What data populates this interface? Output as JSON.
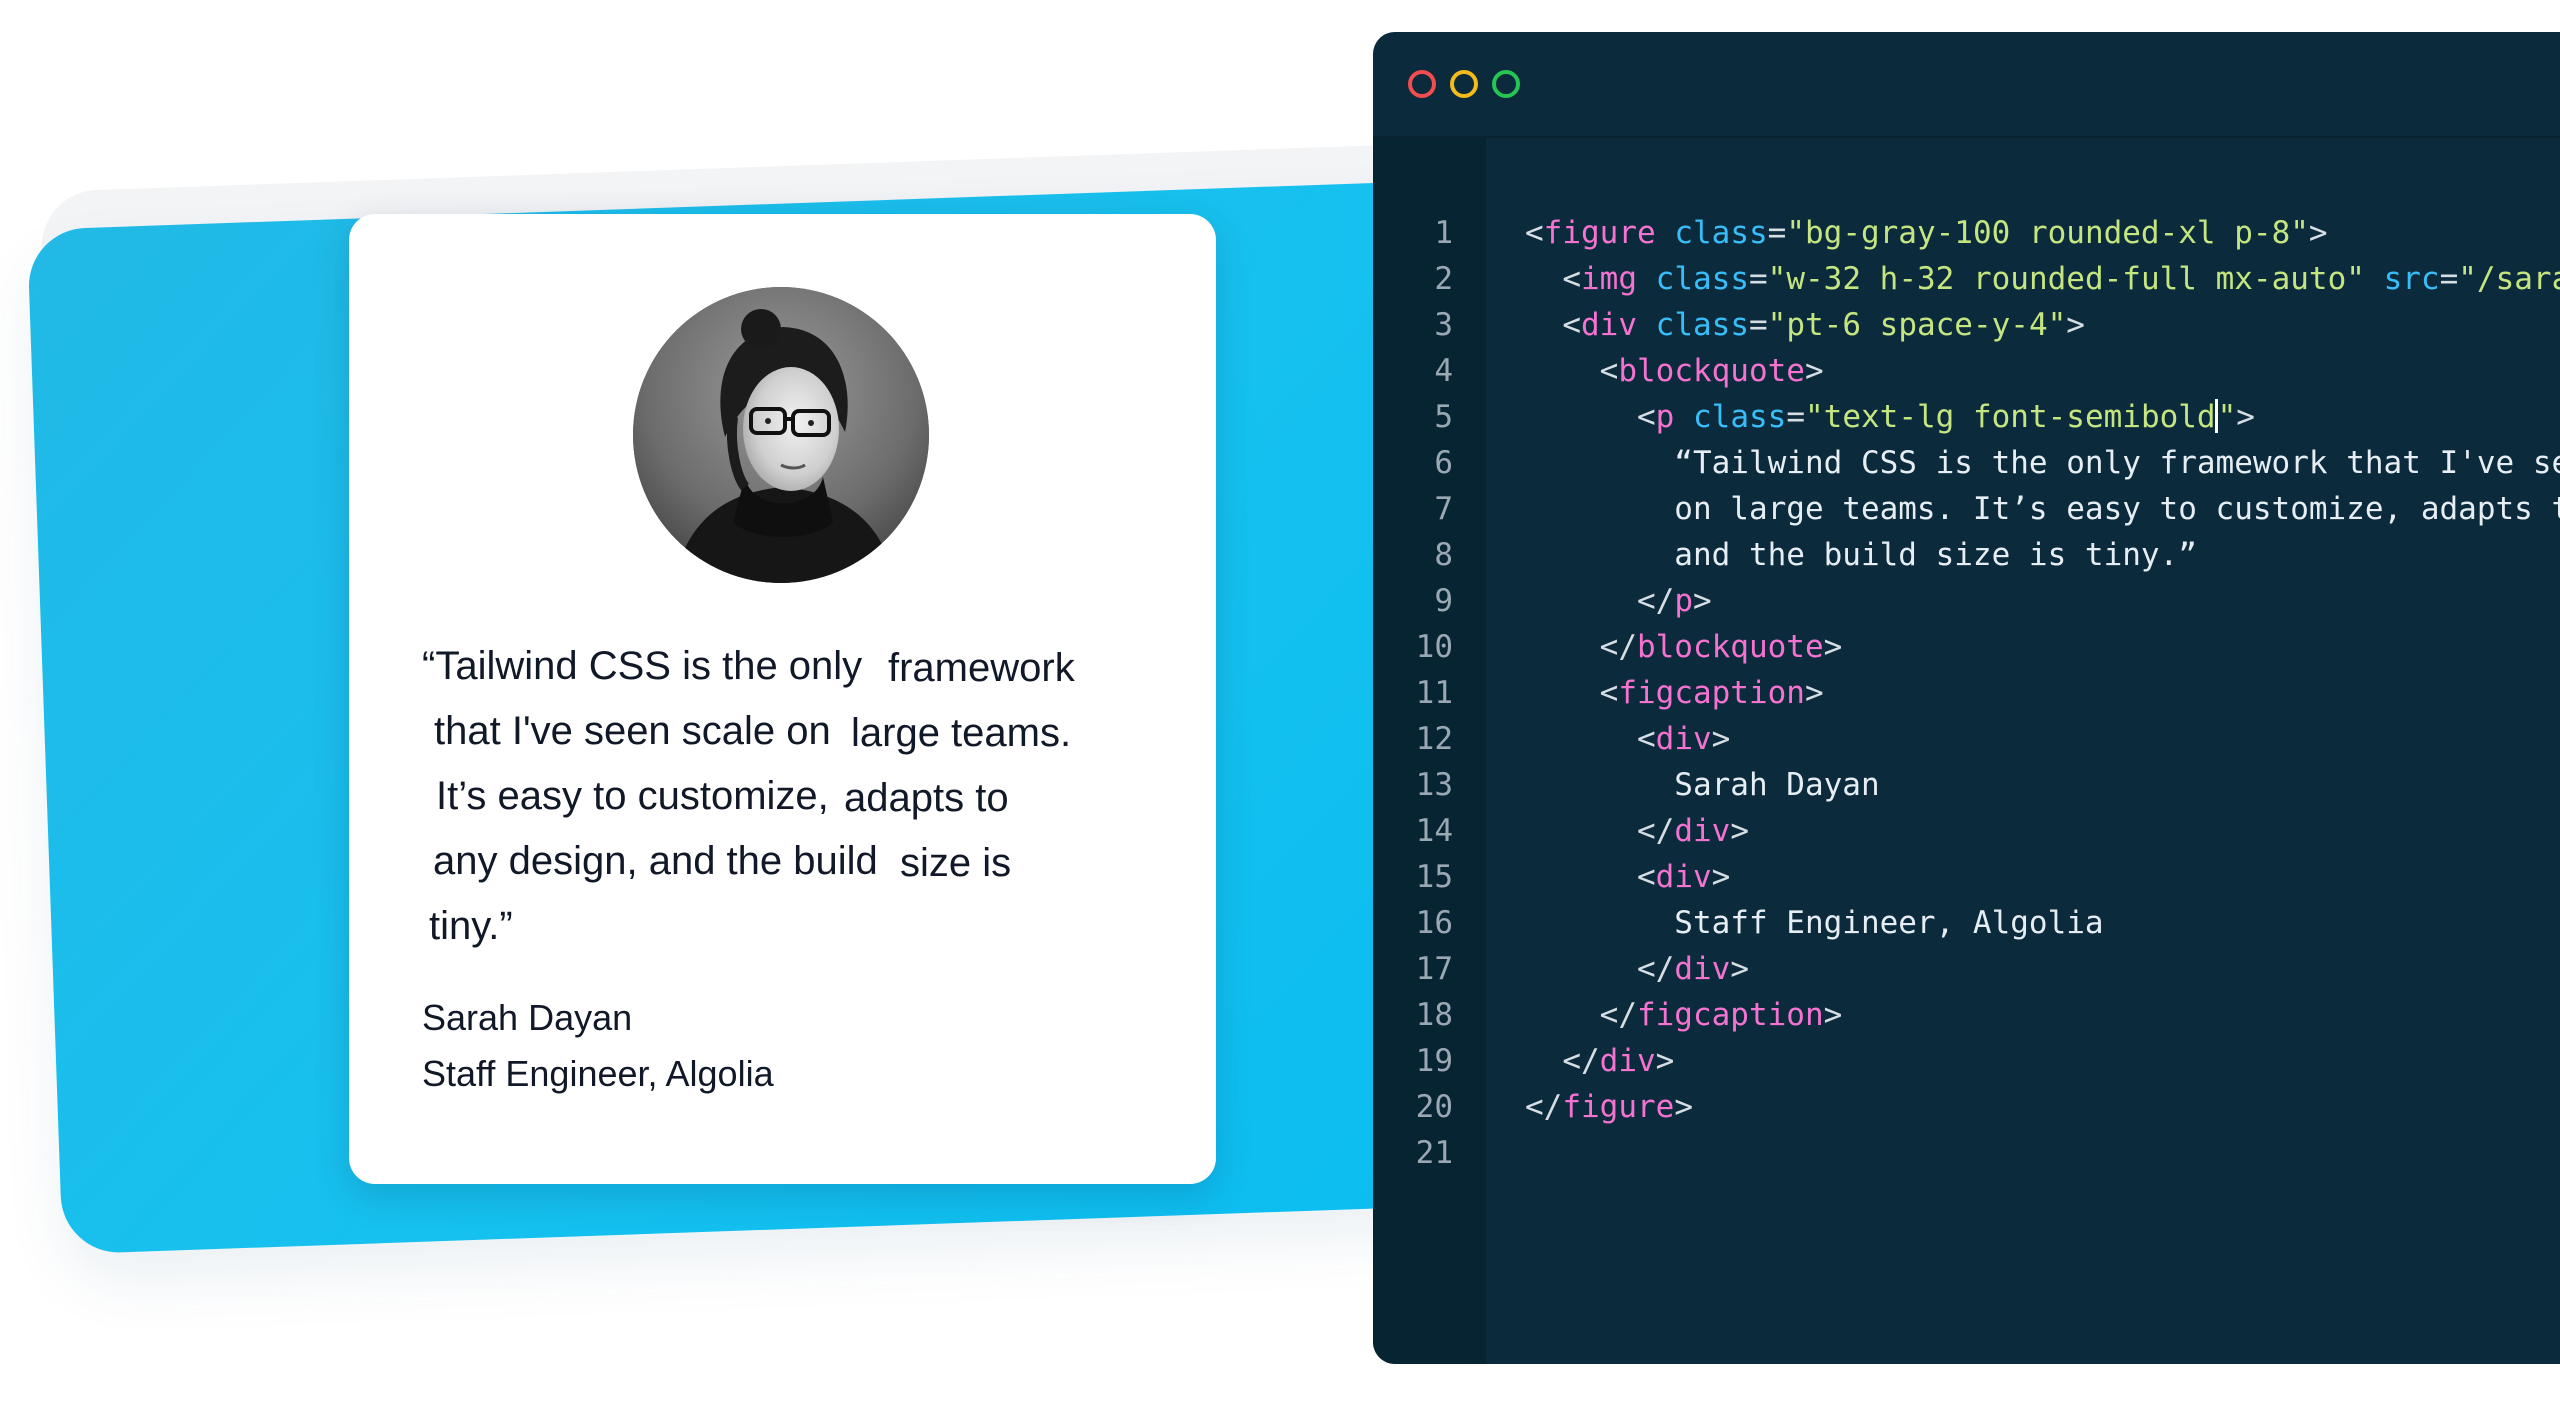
{
  "testimonial": {
    "quote_fragments": [
      "“Tailwind  CSS is the only",
      "framework",
      "that I've seen scale on",
      "large teams.",
      "It’s easy to customize,",
      "adapts to",
      "any design, and the build",
      "size is",
      "tiny.”"
    ],
    "author_name": "Sarah Dayan",
    "author_title": "Staff Engineer, Algolia"
  },
  "editor": {
    "line_numbers": [
      "1",
      "2",
      "3",
      "4",
      "5",
      "6",
      "7",
      "8",
      "9",
      "10",
      "11",
      "12",
      "13",
      "14",
      "15",
      "16",
      "17",
      "18",
      "19",
      "20",
      "21"
    ],
    "code_lines": [
      [
        {
          "t": "<",
          "k": "punct"
        },
        {
          "t": "figure",
          "k": "tag"
        },
        {
          "t": " ",
          "k": "text"
        },
        {
          "t": "class",
          "k": "attr"
        },
        {
          "t": "=",
          "k": "punct"
        },
        {
          "t": "\"bg-gray-100 rounded-xl p-8\"",
          "k": "str"
        },
        {
          "t": ">",
          "k": "punct"
        }
      ],
      [
        {
          "t": "  ",
          "k": "text"
        },
        {
          "t": "<",
          "k": "punct"
        },
        {
          "t": "img",
          "k": "tag"
        },
        {
          "t": " ",
          "k": "text"
        },
        {
          "t": "class",
          "k": "attr"
        },
        {
          "t": "=",
          "k": "punct"
        },
        {
          "t": "\"w-32 h-32 rounded-full mx-auto\"",
          "k": "str"
        },
        {
          "t": " ",
          "k": "text"
        },
        {
          "t": "src",
          "k": "attr"
        },
        {
          "t": "=",
          "k": "punct"
        },
        {
          "t": "\"/sarah-dayan.jpg\"",
          "k": "str"
        }
      ],
      [
        {
          "t": "  ",
          "k": "text"
        },
        {
          "t": "<",
          "k": "punct"
        },
        {
          "t": "div",
          "k": "tag"
        },
        {
          "t": " ",
          "k": "text"
        },
        {
          "t": "class",
          "k": "attr"
        },
        {
          "t": "=",
          "k": "punct"
        },
        {
          "t": "\"pt-6 space-y-4\"",
          "k": "str"
        },
        {
          "t": ">",
          "k": "punct"
        }
      ],
      [
        {
          "t": "    ",
          "k": "text"
        },
        {
          "t": "<",
          "k": "punct"
        },
        {
          "t": "blockquote",
          "k": "tag"
        },
        {
          "t": ">",
          "k": "punct"
        }
      ],
      [
        {
          "t": "      ",
          "k": "text"
        },
        {
          "t": "<",
          "k": "punct"
        },
        {
          "t": "p",
          "k": "tag"
        },
        {
          "t": " ",
          "k": "text"
        },
        {
          "t": "class",
          "k": "attr"
        },
        {
          "t": "=",
          "k": "punct"
        },
        {
          "t": "\"text-lg font-semibold",
          "k": "str"
        },
        {
          "t": "",
          "k": "caret"
        },
        {
          "t": "\"",
          "k": "str"
        },
        {
          "t": ">",
          "k": "punct"
        }
      ],
      [
        {
          "t": "        “Tailwind CSS is the only framework that I've seen scale",
          "k": "text"
        }
      ],
      [
        {
          "t": "        on large teams. It’s easy to customize, adapts to any design,",
          "k": "text"
        }
      ],
      [
        {
          "t": "        and the build size is tiny.”",
          "k": "text"
        }
      ],
      [
        {
          "t": "      ",
          "k": "text"
        },
        {
          "t": "</",
          "k": "punct"
        },
        {
          "t": "p",
          "k": "tag"
        },
        {
          "t": ">",
          "k": "punct"
        }
      ],
      [
        {
          "t": "    ",
          "k": "text"
        },
        {
          "t": "</",
          "k": "punct"
        },
        {
          "t": "blockquote",
          "k": "tag"
        },
        {
          "t": ">",
          "k": "punct"
        }
      ],
      [
        {
          "t": "    ",
          "k": "text"
        },
        {
          "t": "<",
          "k": "punct"
        },
        {
          "t": "figcaption",
          "k": "tag"
        },
        {
          "t": ">",
          "k": "punct"
        }
      ],
      [
        {
          "t": "      ",
          "k": "text"
        },
        {
          "t": "<",
          "k": "punct"
        },
        {
          "t": "div",
          "k": "tag"
        },
        {
          "t": ">",
          "k": "punct"
        }
      ],
      [
        {
          "t": "        Sarah Dayan",
          "k": "text"
        }
      ],
      [
        {
          "t": "      ",
          "k": "text"
        },
        {
          "t": "</",
          "k": "punct"
        },
        {
          "t": "div",
          "k": "tag"
        },
        {
          "t": ">",
          "k": "punct"
        }
      ],
      [
        {
          "t": "      ",
          "k": "text"
        },
        {
          "t": "<",
          "k": "punct"
        },
        {
          "t": "div",
          "k": "tag"
        },
        {
          "t": ">",
          "k": "punct"
        }
      ],
      [
        {
          "t": "        Staff Engineer, Algolia",
          "k": "text"
        }
      ],
      [
        {
          "t": "      ",
          "k": "text"
        },
        {
          "t": "</",
          "k": "punct"
        },
        {
          "t": "div",
          "k": "tag"
        },
        {
          "t": ">",
          "k": "punct"
        }
      ],
      [
        {
          "t": "    ",
          "k": "text"
        },
        {
          "t": "</",
          "k": "punct"
        },
        {
          "t": "figcaption",
          "k": "tag"
        },
        {
          "t": ">",
          "k": "punct"
        }
      ],
      [
        {
          "t": "  ",
          "k": "text"
        },
        {
          "t": "</",
          "k": "punct"
        },
        {
          "t": "div",
          "k": "tag"
        },
        {
          "t": ">",
          "k": "punct"
        }
      ],
      [
        {
          "t": "</",
          "k": "punct"
        },
        {
          "t": "figure",
          "k": "tag"
        },
        {
          "t": ">",
          "k": "punct"
        }
      ],
      []
    ]
  },
  "colors": {
    "accent_blue": "#16c1ef",
    "editor_bg": "#0b2a3c",
    "tag": "#f472d0",
    "attribute": "#38bdf8",
    "string": "#c4e57f",
    "traffic_red": "#f14d4e",
    "traffic_yellow": "#f5bb1a",
    "traffic_green": "#25c453"
  },
  "icons": {
    "window_controls": [
      "close-icon",
      "minimize-icon",
      "zoom-icon"
    ]
  }
}
